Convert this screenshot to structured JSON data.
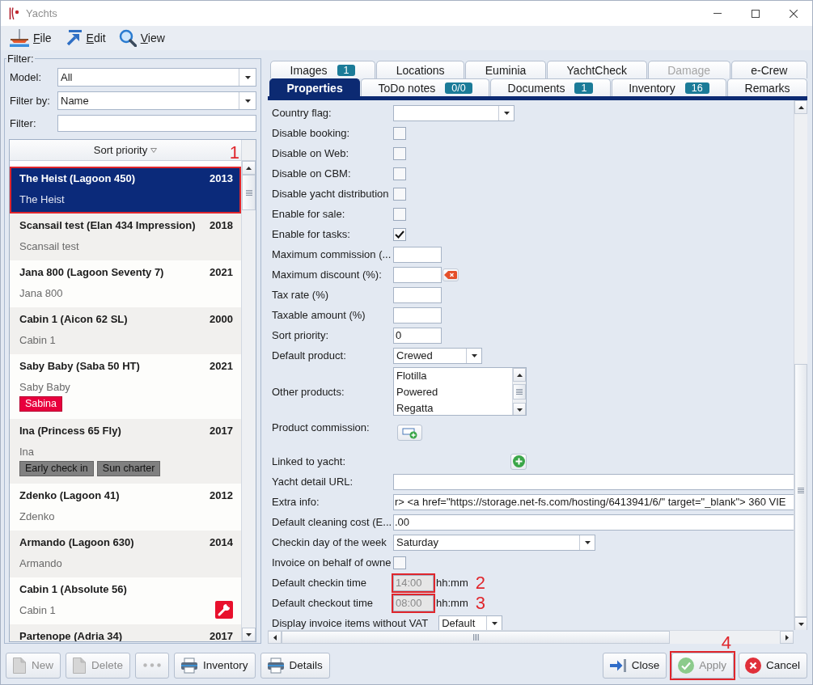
{
  "window": {
    "title": "Yachts"
  },
  "menu": [
    {
      "kind": "file",
      "label": "File"
    },
    {
      "kind": "edit",
      "label": "Edit"
    },
    {
      "kind": "view",
      "label": "View"
    }
  ],
  "filter": {
    "title": "Filter:",
    "model": {
      "label": "Model:",
      "value": "All"
    },
    "filter_by": {
      "label": "Filter by:",
      "value": "Name"
    },
    "text": {
      "label": "Filter:"
    }
  },
  "yacht_list": {
    "header": "Sort priority",
    "items": [
      {
        "title": "The Heist (Lagoon 450)",
        "year": "2013",
        "subtitle": "The Heist",
        "selected": true,
        "maintenance": false,
        "callout": "1"
      },
      {
        "title": "Scansail test (Elan 434 Impression)",
        "year": "2018",
        "subtitle": "Scansail test",
        "selected": false,
        "maintenance": false
      },
      {
        "title": "Jana 800 (Lagoon Seventy 7)",
        "year": "2021",
        "subtitle": "Jana 800",
        "selected": false,
        "maintenance": false
      },
      {
        "title": "Cabin 1 (Aicon 62 SL)",
        "year": "2000",
        "subtitle": "Cabin 1",
        "selected": false,
        "maintenance": false
      },
      {
        "title": "Saby Baby (Saba 50 HT)",
        "year": "2021",
        "subtitle": "Saby Baby",
        "selected": false,
        "maintenance": false,
        "tags": [
          {
            "label": "Sabina",
            "color": "#e8003d"
          }
        ]
      },
      {
        "title": "Ina (Princess 65 Fly)",
        "year": "2017",
        "subtitle": "Ina",
        "selected": false,
        "maintenance": false,
        "tags": [
          {
            "label": "Early check in",
            "color": "#808080"
          },
          {
            "label": "Sun charter",
            "color": "#808080"
          }
        ]
      },
      {
        "title": "Zdenko (Lagoon 41)",
        "year": "2012",
        "subtitle": "Zdenko",
        "selected": false,
        "maintenance": false
      },
      {
        "title": "Armando (Lagoon 630)",
        "year": "2014",
        "subtitle": "Armando",
        "selected": false,
        "maintenance": false
      },
      {
        "title": "Cabin 1 (Absolute 56)",
        "subtitle": "Cabin 1",
        "selected": false,
        "maintenance": true
      },
      {
        "title": "Partenope (Adria 34)",
        "year": "2017",
        "selected": false,
        "maintenance": false
      }
    ]
  },
  "tab_rows": [
    [
      {
        "label": "Images",
        "badge": "1",
        "selected": false,
        "disabled": false
      },
      {
        "label": "Locations",
        "selected": false,
        "disabled": false
      },
      {
        "label": "Euminia",
        "selected": false,
        "disabled": false
      },
      {
        "label": "YachtCheck",
        "selected": false,
        "disabled": false
      },
      {
        "label": "Damage",
        "selected": false,
        "disabled": true
      },
      {
        "label": "e-Crew",
        "selected": false,
        "disabled": false
      }
    ],
    [
      {
        "label": "Properties",
        "selected": true,
        "disabled": false
      },
      {
        "label": "ToDo notes",
        "badge": "0/0",
        "selected": false,
        "disabled": false
      },
      {
        "label": "Documents",
        "badge": "1",
        "selected": false,
        "disabled": false
      },
      {
        "label": "Inventory",
        "badge": "16",
        "selected": false,
        "disabled": false
      },
      {
        "label": "Remarks",
        "selected": false,
        "disabled": false
      }
    ]
  ],
  "properties": {
    "fields": [
      {
        "kind": "combo",
        "label": "Country flag:"
      },
      {
        "kind": "checkbox",
        "label": "Disable booking:",
        "checked": false
      },
      {
        "kind": "checkbox",
        "label": "Disable on Web:",
        "checked": false
      },
      {
        "kind": "checkbox",
        "label": "Disable on CBM:",
        "checked": false
      },
      {
        "kind": "checkbox",
        "label": "Disable yacht distribution",
        "checked": false
      },
      {
        "kind": "checkbox",
        "label": "Enable for sale:",
        "checked": false
      },
      {
        "kind": "checkbox",
        "label": "Enable for tasks:",
        "checked": true
      },
      {
        "kind": "text",
        "label": "Maximum commission (..."
      },
      {
        "kind": "clearable",
        "label": "Maximum discount (%):"
      },
      {
        "kind": "text",
        "label": "Tax rate (%)"
      },
      {
        "kind": "text",
        "label": "Taxable amount (%)"
      },
      {
        "kind": "text",
        "label": "Sort priority:",
        "value": "0"
      },
      {
        "kind": "combo",
        "label": "Default product:",
        "value": "Crewed"
      },
      {
        "kind": "list",
        "label": "Other products:",
        "options": [
          "Flotilla",
          "Powered",
          "Regatta"
        ]
      },
      {
        "kind": "button",
        "label": "Product commission:"
      },
      {
        "kind": "add",
        "label": "Linked to yacht:"
      },
      {
        "kind": "wide",
        "label": "Yacht detail URL:"
      },
      {
        "kind": "wide",
        "label": "Extra info:",
        "value": "r> <a href=\"https://storage.net-fs.com/hosting/6413941/6/\" target=\"_blank\"> 360 VIE"
      },
      {
        "kind": "wide",
        "label": "Default cleaning cost (E...",
        "value": ".00"
      },
      {
        "kind": "combo",
        "label": "Checkin day of the week",
        "value": "Saturday"
      },
      {
        "kind": "checkbox",
        "label": "Invoice on behalf of owne",
        "checked": false
      },
      {
        "kind": "time",
        "label": "Default checkin time",
        "value": "14:00",
        "unit": "hh:mm",
        "disabled": true,
        "callout": "2"
      },
      {
        "kind": "time",
        "label": "Default checkout time",
        "value": "08:00",
        "unit": "hh:mm",
        "disabled": true,
        "callout": "3"
      },
      {
        "kind": "combo",
        "label": "Display invoice items without VAT",
        "value": "Default"
      }
    ]
  },
  "buttons": {
    "left": [
      {
        "kind": "new",
        "label": "New",
        "disabled": true
      },
      {
        "kind": "delete",
        "label": "Delete",
        "disabled": true
      },
      {
        "kind": "more",
        "disabled": true
      },
      {
        "kind": "print",
        "label": "Inventory",
        "disabled": false
      },
      {
        "kind": "print",
        "label": "Details",
        "disabled": false
      }
    ],
    "right": [
      {
        "kind": "close",
        "label": "Close",
        "disabled": false
      },
      {
        "kind": "apply",
        "label": "Apply",
        "disabled": true,
        "callout": "4"
      },
      {
        "kind": "cancel",
        "label": "Cancel",
        "disabled": false
      }
    ]
  }
}
